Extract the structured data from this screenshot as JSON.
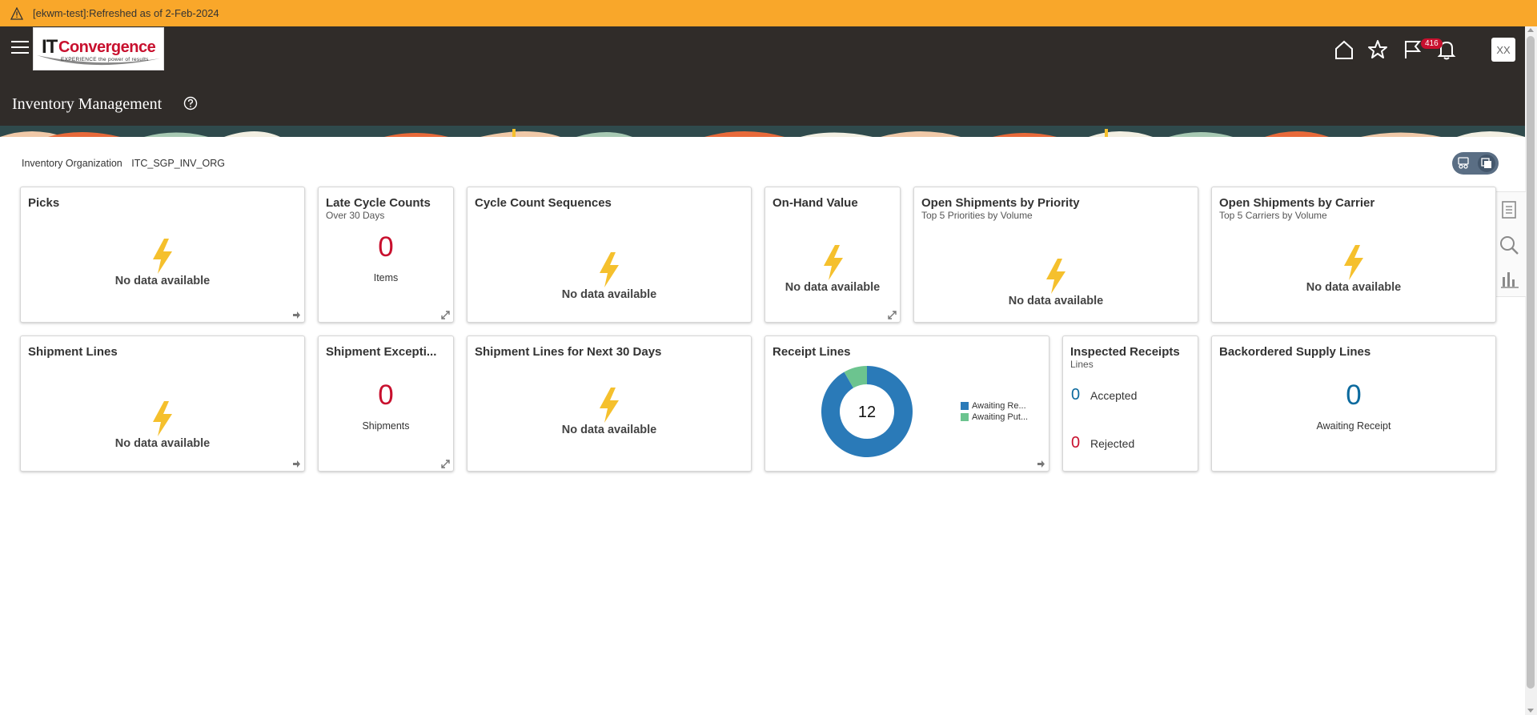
{
  "warning": {
    "text": "[ekwm-test]:Refreshed as of 2-Feb-2024"
  },
  "header": {
    "logo": {
      "it": "IT",
      "name": "Convergence",
      "tagline": "EXPERIENCE the power of results"
    },
    "notification_count": "416",
    "avatar_initials": "XX",
    "page_title": "Inventory Management"
  },
  "filter": {
    "label": "Inventory Organization",
    "value": "ITC_SGP_INV_ORG"
  },
  "colors": {
    "accent_red": "#c8102e",
    "accent_blue": "#0c6a9e",
    "bolt": "#f5c02d",
    "donut_main": "#2a7ab8",
    "donut_minor": "#6cc48f",
    "warning": "#f9a72a"
  },
  "cards": {
    "picks": {
      "title": "Picks",
      "nodata": "No data available"
    },
    "late_cycle": {
      "title": "Late Cycle Counts",
      "subtitle": "Over 30 Days",
      "value": "0",
      "unit": "Items"
    },
    "cycle_seq": {
      "title": "Cycle Count Sequences",
      "nodata": "No data available"
    },
    "onhand": {
      "title": "On-Hand Value",
      "nodata": "No data available"
    },
    "ship_priority": {
      "title": "Open Shipments by Priority",
      "subtitle": "Top 5 Priorities by Volume",
      "nodata": "No data available"
    },
    "ship_carrier": {
      "title": "Open Shipments by Carrier",
      "subtitle": "Top 5 Carriers by Volume",
      "nodata": "No data available"
    },
    "ship_lines": {
      "title": "Shipment Lines",
      "nodata": "No data available"
    },
    "ship_exceptions": {
      "title": "Shipment Excepti...",
      "value": "0",
      "unit": "Shipments"
    },
    "ship_next30": {
      "title": "Shipment Lines for Next 30 Days",
      "nodata": "No data available"
    },
    "receipt_lines": {
      "title": "Receipt Lines",
      "total": "12",
      "legend": [
        "Awaiting Re...",
        "Awaiting Put..."
      ]
    },
    "inspected": {
      "title": "Inspected Receipts",
      "subtitle": "Lines",
      "accepted_value": "0",
      "accepted_label": "Accepted",
      "rejected_value": "0",
      "rejected_label": "Rejected"
    },
    "backordered": {
      "title": "Backordered Supply Lines",
      "value": "0",
      "unit": "Awaiting Receipt"
    }
  },
  "chart_data": {
    "type": "pie",
    "title": "Receipt Lines",
    "series": [
      {
        "name": "Awaiting Re...",
        "value": 11
      },
      {
        "name": "Awaiting Put...",
        "value": 1
      }
    ],
    "center_label": "12"
  }
}
